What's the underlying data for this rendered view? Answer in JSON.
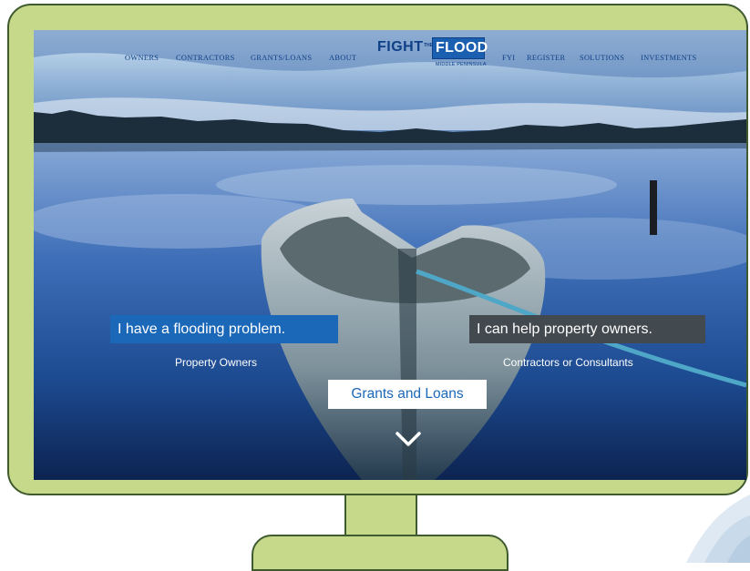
{
  "nav": {
    "left_links": [
      "OWNERS",
      "CONTRACTORS",
      "GRANTS/LOANS",
      "ABOUT"
    ],
    "right_links": [
      "FYI",
      "REGISTER",
      "SOLUTIONS",
      "INVESTMENTS"
    ]
  },
  "logo": {
    "word1": "FIGHT",
    "connector": "THE",
    "word2": "FLOOD",
    "subtitle": "MIDDLE PENINSULA"
  },
  "hero": {
    "owners_cta": "I have a flooding problem.",
    "owners_sub": "Property Owners",
    "contractors_cta": "I can help property owners.",
    "contractors_sub": "Contractors or Consultants",
    "grants_cta": "Grants and Loans",
    "scroll_icon": "chevron-down-icon"
  },
  "colors": {
    "frame": "#c6d88a",
    "frame_border": "#3f5a2e",
    "brand_blue": "#1b67b8",
    "nav_blue": "#0f3f86",
    "dark_button": "#424a50"
  }
}
